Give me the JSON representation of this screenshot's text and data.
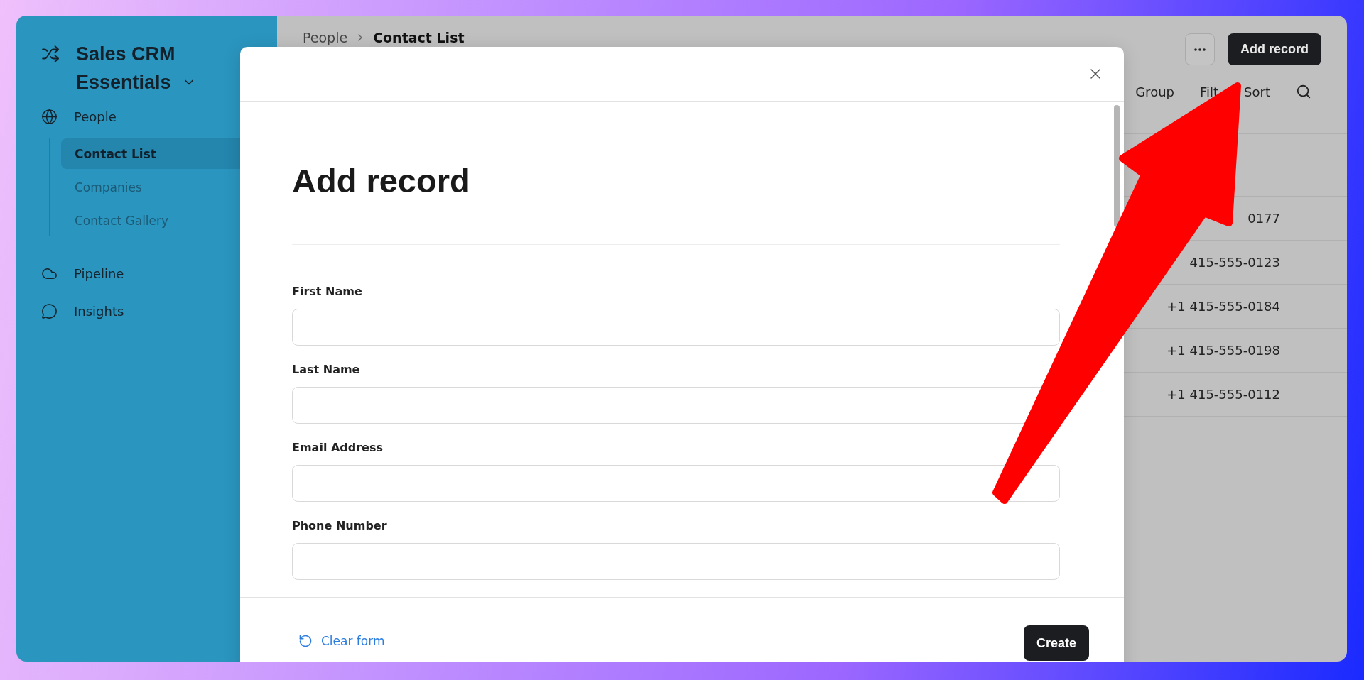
{
  "app": {
    "name": "Sales CRM Essentials"
  },
  "sidebar": {
    "items": [
      {
        "label": "People",
        "selected": false,
        "children": [
          {
            "label": "Contact List",
            "selected": true
          },
          {
            "label": "Companies",
            "selected": false
          },
          {
            "label": "Contact Gallery",
            "selected": false
          }
        ]
      },
      {
        "label": "Pipeline",
        "selected": false
      },
      {
        "label": "Insights",
        "selected": false
      }
    ]
  },
  "breadcrumb": [
    "People",
    "Contact List"
  ],
  "header": {
    "primary_button": "Add record"
  },
  "toolbar": [
    "Group",
    "Filt",
    "Sort"
  ],
  "table": {
    "rows": [
      {
        "phone": "0177"
      },
      {
        "phone": "415-555-0123"
      },
      {
        "phone": "+1 415-555-0184"
      },
      {
        "phone": "+1 415-555-0198"
      },
      {
        "phone": "+1 415-555-0112"
      }
    ]
  },
  "modal": {
    "title": "Add record",
    "fields": [
      {
        "label": "First Name"
      },
      {
        "label": "Last Name"
      },
      {
        "label": "Email Address"
      },
      {
        "label": "Phone Number"
      }
    ],
    "clear_link": "Clear form",
    "submit": "Create"
  }
}
